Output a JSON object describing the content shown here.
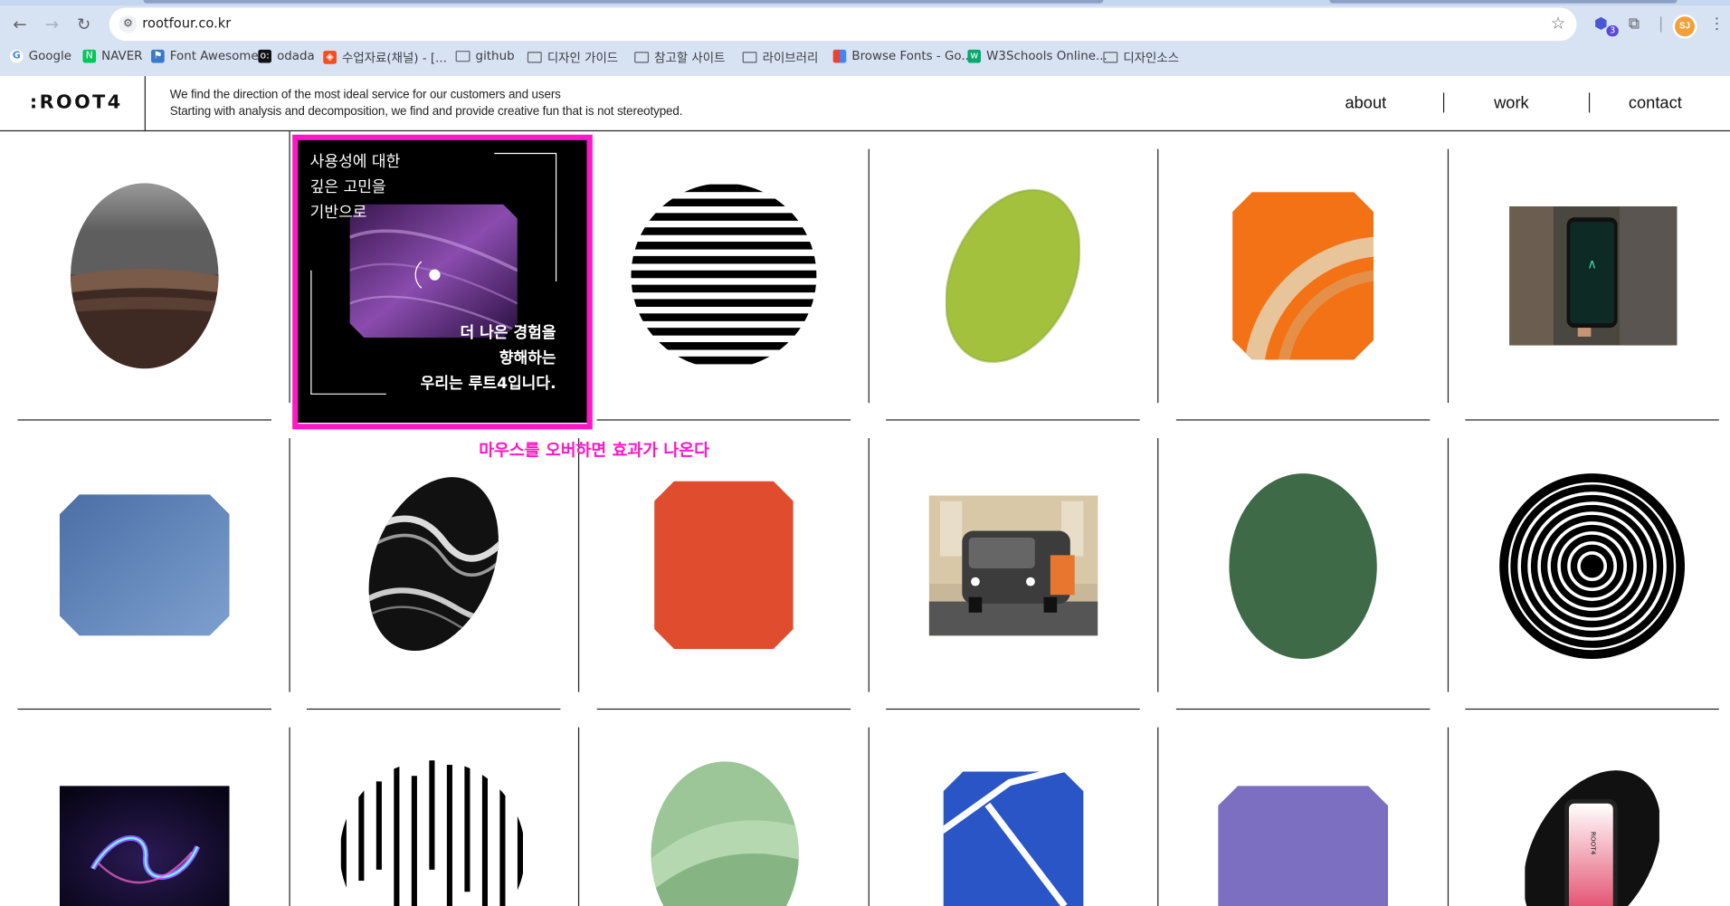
{
  "browser": {
    "url": "rootfour.co.kr",
    "extension_badge": "3",
    "profile_initials": "SJ",
    "bookmarks": [
      {
        "label": "Google",
        "icon": "google-icon"
      },
      {
        "label": "NAVER",
        "icon": "naver-icon"
      },
      {
        "label": "Font Awesome",
        "icon": "flag-icon"
      },
      {
        "label": "odada",
        "icon": "odada-icon"
      },
      {
        "label": "수업자료(채널) - [...",
        "icon": "figma-icon"
      },
      {
        "label": "github",
        "icon": "folder-icon"
      },
      {
        "label": "디자인 가이드",
        "icon": "folder-icon"
      },
      {
        "label": "참고할 사이트",
        "icon": "folder-icon"
      },
      {
        "label": "라이브러리",
        "icon": "folder-icon"
      },
      {
        "label": "Browse Fonts - Go...",
        "icon": "google-fonts-icon"
      },
      {
        "label": "W3Schools Online...",
        "icon": "w3schools-icon"
      },
      {
        "label": "디자인소스",
        "icon": "folder-icon"
      }
    ]
  },
  "site": {
    "logo": ":ROOT4",
    "tagline_line1": "We find the direction of the most ideal service for our customers and users",
    "tagline_line2": "Starting with analysis and decomposition, we find and provide creative fun that is not stereotyped.",
    "nav": [
      {
        "label": "about"
      },
      {
        "label": "work"
      },
      {
        "label": "contact"
      }
    ]
  },
  "hover_card": {
    "top_text": [
      "사용성에 대한",
      "깊은 고민을",
      "기반으로"
    ],
    "bottom_text": [
      "더 나은 경험을",
      "향해하는",
      "우리는 루트4입니다."
    ]
  },
  "annotation": "마우스를 오버하면 효과가 나온다",
  "portfolio_items": [
    {
      "name": "gray-brown-oval",
      "colors": [
        "#8c8c8c",
        "#5a4034"
      ]
    },
    {
      "name": "hover-card-item",
      "colors": [
        "#000000"
      ]
    },
    {
      "name": "black-stripe-circle",
      "colors": [
        "#000000",
        "#ffffff"
      ]
    },
    {
      "name": "green-tilted-oval",
      "colors": [
        "#a3c13c"
      ]
    },
    {
      "name": "orange-octagon",
      "colors": [
        "#f47216",
        "#e8c49a"
      ]
    },
    {
      "name": "phone-photo",
      "colors": [
        "#4a4640"
      ]
    },
    {
      "name": "blue-octagon",
      "colors": [
        "#5b7fb5"
      ]
    },
    {
      "name": "black-marble-oval",
      "colors": [
        "#111111",
        "#cccccc"
      ]
    },
    {
      "name": "red-octagon",
      "colors": [
        "#e04d2e"
      ]
    },
    {
      "name": "vehicle-photo",
      "colors": [
        "#c9b79a"
      ]
    },
    {
      "name": "dark-green-oval",
      "colors": [
        "#3f6a47"
      ]
    },
    {
      "name": "concentric-circles",
      "colors": [
        "#000000",
        "#ffffff"
      ]
    },
    {
      "name": "neon-infinity-photo",
      "colors": [
        "#120a2a",
        "#8d5bff"
      ]
    },
    {
      "name": "vertical-stripe-circle",
      "colors": [
        "#000000",
        "#ffffff"
      ]
    },
    {
      "name": "mint-green-oval",
      "colors": [
        "#9cc698"
      ]
    },
    {
      "name": "blue-court-octagon",
      "colors": [
        "#2a55c6",
        "#ffffff"
      ]
    },
    {
      "name": "purple-octagon",
      "colors": [
        "#7c6ec0"
      ]
    },
    {
      "name": "root4-phone-oval",
      "colors": [
        "#111111",
        "#ffffff"
      ]
    }
  ]
}
